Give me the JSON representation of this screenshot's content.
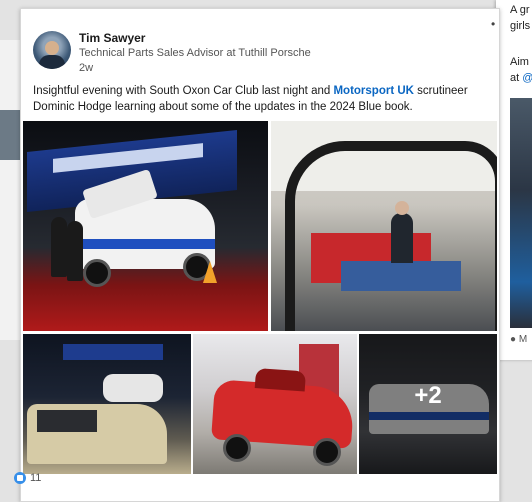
{
  "post": {
    "author_name": "Tim Sawyer",
    "author_title": "Technical Parts Sales Advisor at Tuthill Porsche",
    "time_ago": "2w",
    "text_before": "Insightful evening with South Oxon Car Club last night and ",
    "mention": "Motorsport UK",
    "text_after": " scrutineer Dominic Hodge learning about some of the updates in the 2024 Blue book.",
    "more_photos": "+2",
    "reaction_count": "11",
    "reaction_icon": "like-icon"
  },
  "side_post": {
    "line1": "A gr",
    "line2": "girls",
    "line3": "Aim",
    "line4_prefix": "at ",
    "line4_link": "@",
    "footer": "M"
  },
  "colors": {
    "link": "#0a66c2",
    "like": "#378fe9"
  }
}
